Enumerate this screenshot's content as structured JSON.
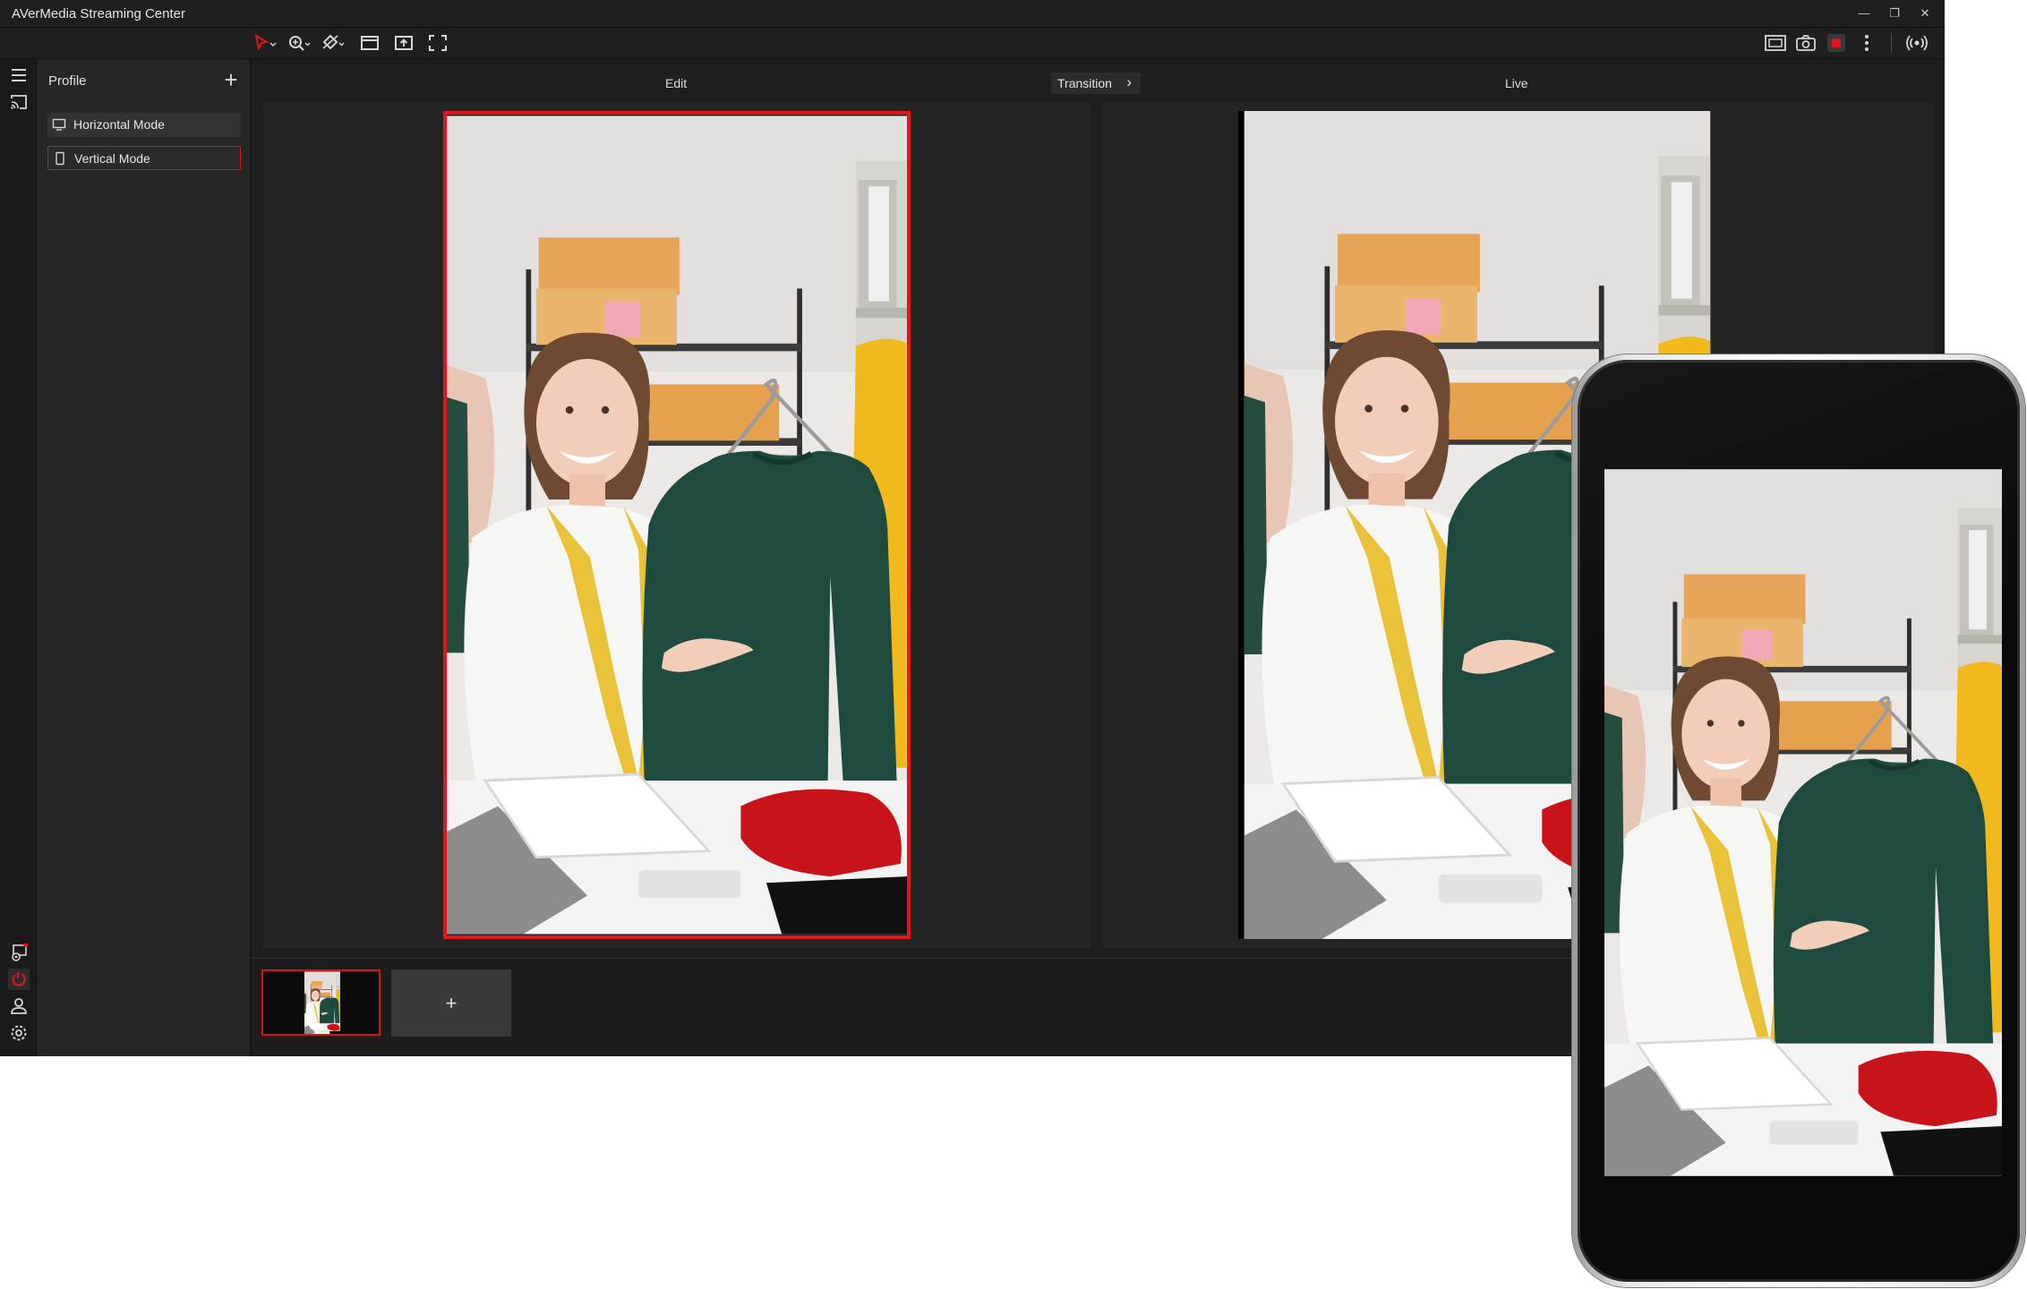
{
  "window": {
    "title": "AVerMedia Streaming Center",
    "controls": [
      "minimize-icon",
      "restore-icon",
      "close-icon"
    ]
  },
  "toolbar": {
    "left_icons": [
      "select-arrow-icon",
      "zoom-icon",
      "rotate-icon",
      "window-icon",
      "upload-icon",
      "fullscreen-icon"
    ],
    "right_icons": [
      "capture-icon",
      "camera-icon",
      "record-icon",
      "more-icon",
      "broadcast-icon"
    ],
    "record_color": "#e3151b"
  },
  "rail": {
    "top_icons": [
      "menu-icon",
      "cast-icon"
    ],
    "bottom_icons": [
      "scene-settings-icon",
      "power-icon",
      "user-icon",
      "settings-icon"
    ]
  },
  "profile": {
    "title": "Profile",
    "add_label": "+",
    "modes": [
      {
        "label": "Horizontal Mode",
        "icon": "monitor-icon",
        "selected": false
      },
      {
        "label": "Vertical Mode",
        "icon": "phone-icon",
        "selected": true
      }
    ]
  },
  "main": {
    "edit_label": "Edit",
    "transition_label": "Transition",
    "live_label": "Live"
  },
  "scenes": {
    "add_label": "+"
  },
  "colors": {
    "accent": "#e3151b",
    "background": "#1c1c1c",
    "panel": "#262626"
  }
}
